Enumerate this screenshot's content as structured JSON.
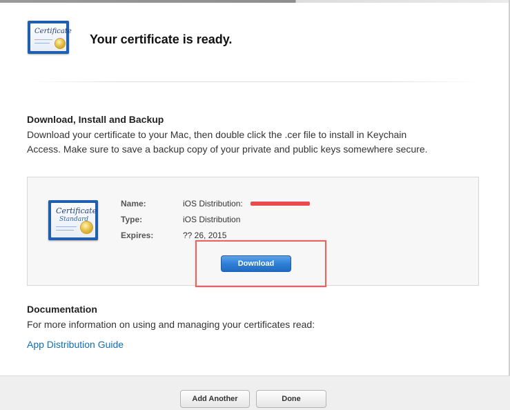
{
  "header": {
    "title": "Your certificate is ready.",
    "icon": "certificate-icon",
    "icon_text": "Certificate"
  },
  "download_section": {
    "heading": "Download, Install and Backup",
    "body_line1": "Download your certificate to your Mac, then double click the .cer file to install in Keychain",
    "body_line2": "Access. Make sure to save a backup copy of your private and public keys somewhere secure."
  },
  "certificate": {
    "icon": "certificate-icon",
    "icon_text": "Certificate",
    "icon_subtext": "Standard",
    "fields": [
      {
        "label": "Name:",
        "value": "iOS Distribution:"
      },
      {
        "label": "Type:",
        "value": "iOS Distribution"
      },
      {
        "label": "Expires:",
        "value": "?? 26, 2015"
      }
    ],
    "download_label": "Download"
  },
  "documentation": {
    "heading": "Documentation",
    "body": "For more information on using and managing your certificates read:",
    "link_label": "App Distribution Guide"
  },
  "footer": {
    "add_another_label": "Add Another",
    "done_label": "Done"
  },
  "colors": {
    "accent_blue": "#2f7fd6",
    "link_blue": "#0a6fc2",
    "highlight_red": "#e8635e",
    "redaction_red": "#ef4a4a"
  }
}
